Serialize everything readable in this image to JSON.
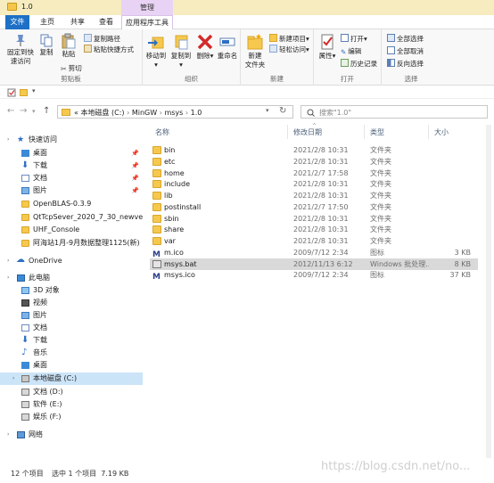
{
  "window": {
    "title": "1.0",
    "manage_tab": "管理"
  },
  "ribbon_tabs": {
    "file": "文件",
    "home": "主页",
    "share": "共享",
    "view": "查看",
    "app_tools": "应用程序工具"
  },
  "clipboard": {
    "pin_quick_access": "固定到快速访问",
    "copy": "复制",
    "paste": "粘贴",
    "copy_path": "复制路径",
    "paste_shortcut": "粘贴快捷方式",
    "cut": "剪切",
    "group_label": "剪贴板"
  },
  "organize": {
    "move_to": "移动到",
    "copy_to": "复制到",
    "delete": "删除",
    "rename": "重命名",
    "group_label": "组织"
  },
  "new_group": {
    "new_folder": "新建\n文件夹",
    "new_item": "新建项目",
    "easy_access": "轻松访问",
    "group_label": "新建"
  },
  "open_group": {
    "properties": "属性",
    "open": "打开",
    "edit": "编辑",
    "history": "历史记录",
    "group_label": "打开"
  },
  "select_group": {
    "select_all": "全部选择",
    "select_none": "全部取消",
    "invert": "反向选择",
    "group_label": "选择"
  },
  "address": {
    "prefix": "«",
    "parts": [
      "本地磁盘 (C:)",
      "MinGW",
      "msys",
      "1.0"
    ],
    "search_placeholder": "搜索\"1.0\""
  },
  "nav_pane": {
    "quick_access": "快速访问",
    "desktop": "桌面",
    "downloads": "下载",
    "documents": "文档",
    "pictures": "图片",
    "folders": [
      "OpenBLAS-0.3.9",
      "QtTcpSever_2020_7_30_newversion",
      "UHF_Console",
      "阿海站1月-9月数据整理1125(新)"
    ],
    "onedrive": "OneDrive",
    "this_pc": "此电脑",
    "pc_items": [
      "3D 对象",
      "视频",
      "图片",
      "文档",
      "下载",
      "音乐",
      "桌面",
      "本地磁盘 (C:)",
      "文档 (D:)",
      "软件 (E:)",
      "娱乐 (F:)"
    ],
    "network": "网络"
  },
  "columns": {
    "name": "名称",
    "date": "修改日期",
    "type": "类型",
    "size": "大小"
  },
  "files": [
    {
      "name": "bin",
      "date": "2021/2/8 10:31",
      "type": "文件夹",
      "size": "",
      "kind": "folder"
    },
    {
      "name": "etc",
      "date": "2021/2/8 10:31",
      "type": "文件夹",
      "size": "",
      "kind": "folder"
    },
    {
      "name": "home",
      "date": "2021/2/7 17:58",
      "type": "文件夹",
      "size": "",
      "kind": "folder"
    },
    {
      "name": "include",
      "date": "2021/2/8 10:31",
      "type": "文件夹",
      "size": "",
      "kind": "folder"
    },
    {
      "name": "lib",
      "date": "2021/2/8 10:31",
      "type": "文件夹",
      "size": "",
      "kind": "folder"
    },
    {
      "name": "postinstall",
      "date": "2021/2/7 17:50",
      "type": "文件夹",
      "size": "",
      "kind": "folder"
    },
    {
      "name": "sbin",
      "date": "2021/2/8 10:31",
      "type": "文件夹",
      "size": "",
      "kind": "folder"
    },
    {
      "name": "share",
      "date": "2021/2/8 10:31",
      "type": "文件夹",
      "size": "",
      "kind": "folder"
    },
    {
      "name": "var",
      "date": "2021/2/8 10:31",
      "type": "文件夹",
      "size": "",
      "kind": "folder"
    },
    {
      "name": "m.ico",
      "date": "2009/7/12 2:34",
      "type": "图标",
      "size": "3 KB",
      "kind": "ico"
    },
    {
      "name": "msys.bat",
      "date": "2012/11/13 6:12",
      "type": "Windows 批处理...",
      "size": "8 KB",
      "kind": "bat"
    },
    {
      "name": "msys.ico",
      "date": "2009/7/12 2:34",
      "type": "图标",
      "size": "37 KB",
      "kind": "ico"
    }
  ],
  "status": {
    "count": "12 个项目",
    "selected": "选中 1 个项目  7.19 KB"
  },
  "watermark": "https://blog.csdn.net/no..."
}
